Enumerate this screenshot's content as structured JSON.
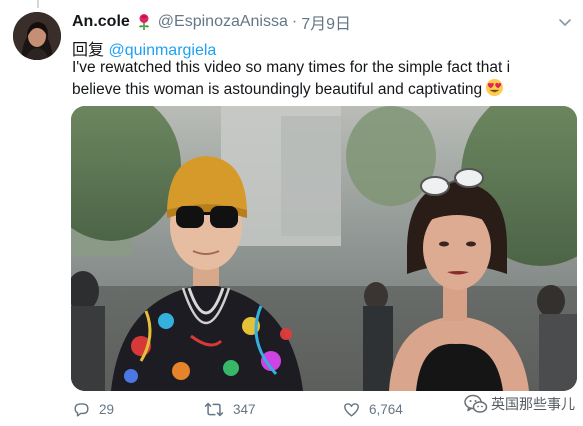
{
  "tweet": {
    "display_name": "An.cole",
    "name_emoji_icon": "rose-icon",
    "handle": "@EspinozaAnissa",
    "separator": "·",
    "date": "7月9日",
    "reply_prefix": "回复",
    "reply_to": "@quinmargiela",
    "text_line1": "I've rewatched this video so many times for the simple fact that i",
    "text_line2": "believe this woman is astoundingly beautiful and captivating",
    "text_emoji_icon": "heart-eyes-emoji-icon",
    "media_icon": "video-thumbnail-two-women-street"
  },
  "actions": {
    "reply_count": "29",
    "retweet_count": "347",
    "like_count": "6,764"
  },
  "watermark": {
    "text": "英国那些事儿",
    "icon": "wechat-icon"
  },
  "colors": {
    "link": "#1da1f2",
    "secondary_text": "#657786",
    "primary_text": "#14171a"
  }
}
